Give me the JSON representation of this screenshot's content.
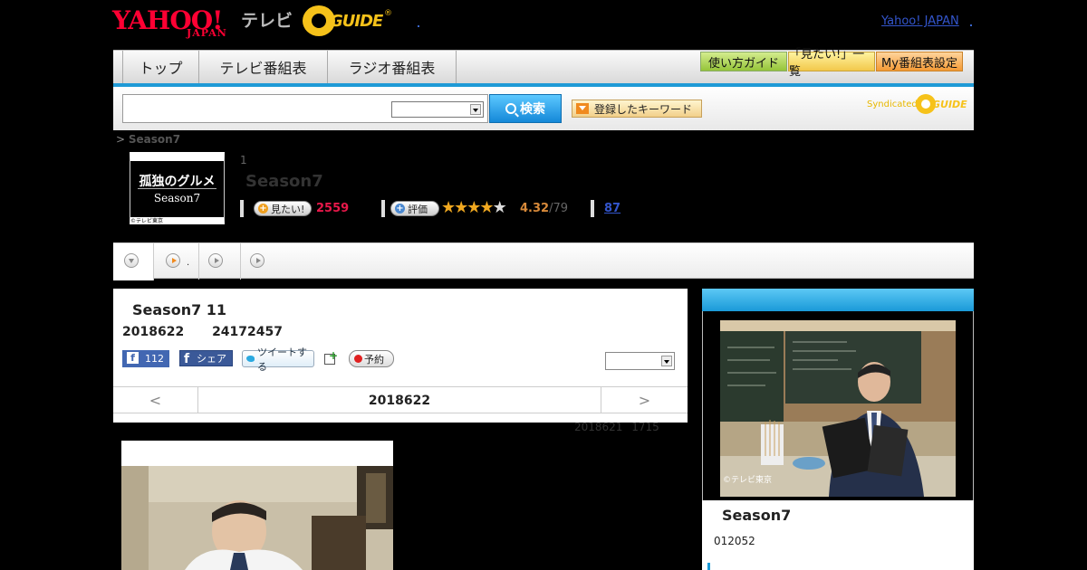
{
  "header": {
    "logo_yahoo": "YAHOO!",
    "logo_japan": "JAPAN",
    "logo_tv": "テレビ",
    "logo_gguide": "GUIDE",
    "top_link": "Yahoo! JAPAN"
  },
  "nav": {
    "tabs": [
      "トップ",
      "テレビ番組表",
      "ラジオ番組表"
    ],
    "buttons": [
      "使い方ガイド",
      "「見たい!」一覧",
      "My番組表設定"
    ]
  },
  "search": {
    "button_label": "検索",
    "keyword_button": "登録したキーワード",
    "syndicated": "Syndicated",
    "syndicated_logo": "GUIDE"
  },
  "breadcrumb": {
    "sep": ">",
    "current": "Season7"
  },
  "program": {
    "thumb_title": "孤独のグルメ",
    "thumb_season": "Season7",
    "thumb_copyright": "©テレビ東京",
    "episode_index": "1",
    "title": "Season7",
    "want_label": "見たい!",
    "want_count": "2559",
    "eval_label": "評価",
    "rating": 4.32,
    "rating_text": "4.32",
    "rating_count": "/79",
    "review_link": "87"
  },
  "tabs": {
    "dot": "."
  },
  "episode": {
    "title": "Season7 11",
    "date": "2018622 24172457",
    "fb_like_count": "112",
    "fb_share": "シェア",
    "tweet": "ツイートする",
    "reserve": "予約",
    "nav_prev": "<",
    "nav_current": "2018622",
    "nav_next": ">",
    "updated": "2018621 1715"
  },
  "sidebar": {
    "image_copyright": "©テレビ東京",
    "title": "Season7",
    "subtitle": "012052"
  }
}
